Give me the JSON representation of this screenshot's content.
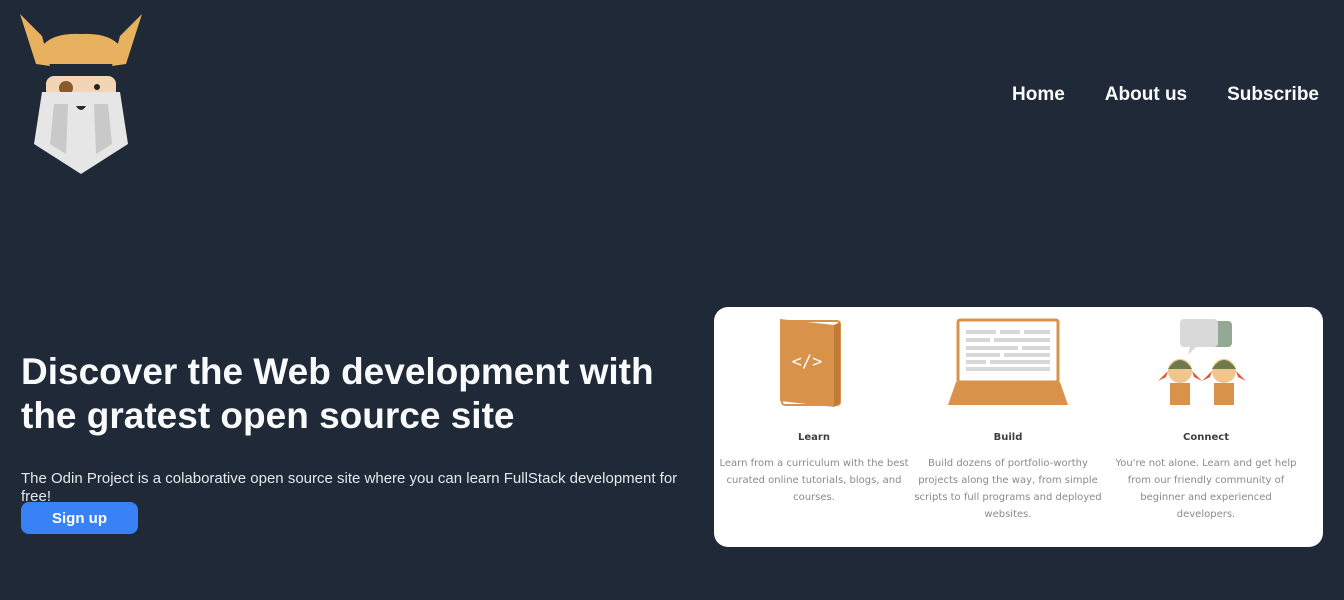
{
  "header": {
    "logo_icon": "odin-viking-logo-icon",
    "nav": [
      {
        "label": "Home"
      },
      {
        "label": "About us"
      },
      {
        "label": "Subscribe"
      }
    ]
  },
  "hero": {
    "title": "Discover the Web development with the gratest open source site",
    "subtitle": "The Odin Project is a colaborative open source site where you can learn FullStack development for free!",
    "signup_label": "Sign up"
  },
  "features": [
    {
      "icon": "book-code-icon",
      "title": "Learn",
      "description": "Learn from a curriculum with the best curated online tutorials, blogs, and courses."
    },
    {
      "icon": "laptop-icon",
      "title": "Build",
      "description": "Build dozens of portfolio-worthy projects along the way, from simple scripts to full programs and deployed websites."
    },
    {
      "icon": "community-chat-icon",
      "title": "Connect",
      "description": "You're not alone. Learn and get help from our friendly community of beginner and experienced developers."
    }
  ],
  "colors": {
    "background": "#1f2937",
    "button": "#3882f6",
    "accent_orange": "#d9924a",
    "card": "#ffffff"
  }
}
